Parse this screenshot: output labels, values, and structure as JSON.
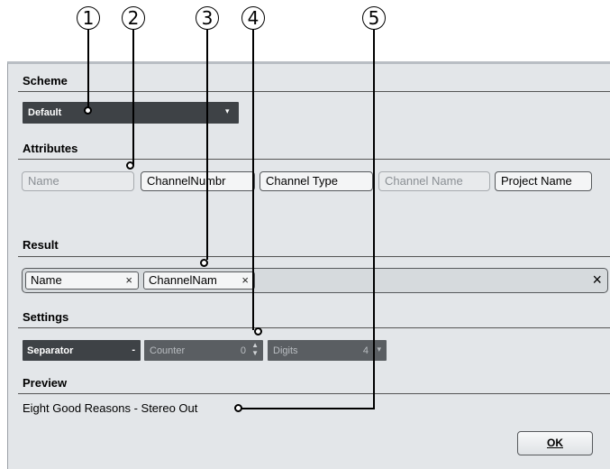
{
  "callouts": [
    "1",
    "2",
    "3",
    "4",
    "5"
  ],
  "dialog": {
    "scheme": {
      "label": "Scheme",
      "value": "Default",
      "arrow_icon": "chevron-down-icon"
    },
    "attributes": {
      "label": "Attributes",
      "buttons": [
        {
          "label": "Name",
          "enabled": false
        },
        {
          "label": "ChannelNumbr",
          "enabled": true
        },
        {
          "label": "Channel Type",
          "enabled": true
        },
        {
          "label": "Channel Name",
          "enabled": false
        },
        {
          "label": "Project Name",
          "enabled": true
        }
      ]
    },
    "result": {
      "label": "Result",
      "tokens": [
        {
          "label": "Name",
          "remove": "×"
        },
        {
          "label": "ChannelNam",
          "remove": "×"
        }
      ],
      "clear": "×"
    },
    "settings": {
      "label": "Settings",
      "separator": {
        "label": "Separator",
        "value": "-"
      },
      "counter": {
        "label": "Counter",
        "value": "0"
      },
      "digits": {
        "label": "Digits",
        "value": "4"
      }
    },
    "preview": {
      "label": "Preview",
      "text": "Eight Good Reasons - Stereo Out"
    },
    "ok_button": "OK"
  },
  "colors": {
    "dialog_bg": "#e3e6e9",
    "dark_control": "#3e4246",
    "disabled_control": "#5a5e62"
  }
}
